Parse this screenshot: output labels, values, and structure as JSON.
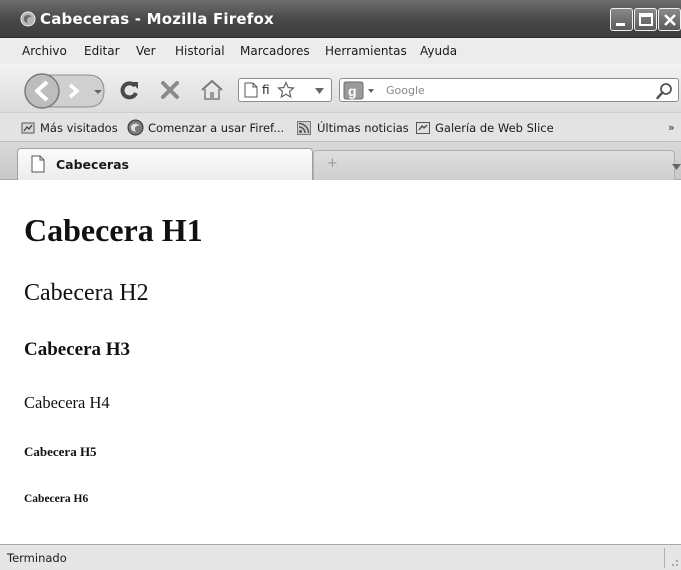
{
  "window": {
    "title": "Cabeceras - Mozilla Firefox"
  },
  "menu": {
    "items": [
      "Archivo",
      "Editar",
      "Ver",
      "Historial",
      "Marcadores",
      "Herramientas",
      "Ayuda"
    ]
  },
  "toolbar": {
    "url_text": "fi",
    "search_placeholder": "Google"
  },
  "bookmarks": {
    "items": [
      "Más visitados",
      "Comenzar a usar Firef...",
      "Últimas noticias",
      "Galería de Web Slice"
    ],
    "overflow": "»"
  },
  "tabs": {
    "active_label": "Cabeceras",
    "new_tab_symbol": "+"
  },
  "page": {
    "h1": "Cabecera H1",
    "h2": "Cabecera H2",
    "h3": "Cabecera H3",
    "h4": "Cabecera H4",
    "h5": "Cabecera H5",
    "h6": "Cabecera H6"
  },
  "status": {
    "text": "Terminado"
  },
  "icons": {
    "app": "firefox-icon",
    "back": "back-arrow-icon",
    "forward": "forward-arrow-icon",
    "reload": "reload-icon",
    "stop": "stop-icon",
    "home": "home-icon",
    "page": "page-icon",
    "star": "bookmark-star-icon",
    "search_engine": "google-icon",
    "search": "magnifier-icon"
  }
}
